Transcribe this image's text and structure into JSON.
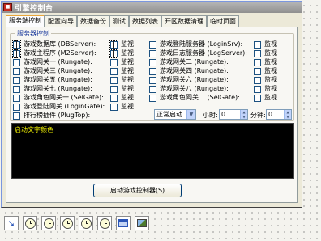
{
  "window": {
    "title": "引擎控制台"
  },
  "tabs": [
    "服务端控制",
    "配置向导",
    "数据备份",
    "测试",
    "数据列表",
    "开区数据清理",
    "临时页面"
  ],
  "group": {
    "title": "服务器控制"
  },
  "servers_left": [
    {
      "label": "游戏数据库 (DBServer):",
      "monitor": "监视"
    },
    {
      "label": "游戏主程序 (M2Server):",
      "monitor": "监视"
    },
    {
      "label": "游戏网关一 (Rungate):",
      "monitor": "监视"
    },
    {
      "label": "游戏网关三 (Rungate):",
      "monitor": "监视"
    },
    {
      "label": "游戏网关五 (Rungate):",
      "monitor": "监视"
    },
    {
      "label": "游戏网关七 (Rungate):",
      "monitor": "监视"
    },
    {
      "label": "游戏角色网关一 (SelGate):",
      "monitor": "监视"
    },
    {
      "label": "游戏登陆网关 (LoginGate):",
      "monitor": "监视"
    },
    {
      "label": "排行榜插件 (PlugTop):",
      "monitor": ""
    }
  ],
  "servers_right": [
    {
      "label": "游戏登陆服务器 (LoginSrv):",
      "monitor": "监视"
    },
    {
      "label": "游戏日志服务器 (LogServer):",
      "monitor": "监视"
    },
    {
      "label": "游戏网关二 (Rungate):",
      "monitor": "监视"
    },
    {
      "label": "游戏网关四 (Rungate):",
      "monitor": "监视"
    },
    {
      "label": "游戏网关六 (Rungate):",
      "monitor": "监视"
    },
    {
      "label": "游戏网关八 (Rungate):",
      "monitor": "监视"
    },
    {
      "label": "游戏角色网关二 (SelGate):",
      "monitor": "监视"
    }
  ],
  "schedule": {
    "mode": "正常启动",
    "hour_label": "小时:",
    "hour_value": "0",
    "minute_label": "分钟:",
    "minute_value": "0"
  },
  "console": {
    "text": "启动文字颜色"
  },
  "start_button": {
    "label": "启动游戏控制器(S)"
  },
  "toolbar": [
    "arrow-icon",
    "clock-icon",
    "clock-icon",
    "clock-icon",
    "clock-icon",
    "clock-icon",
    "panel-icon",
    "image-icon"
  ]
}
